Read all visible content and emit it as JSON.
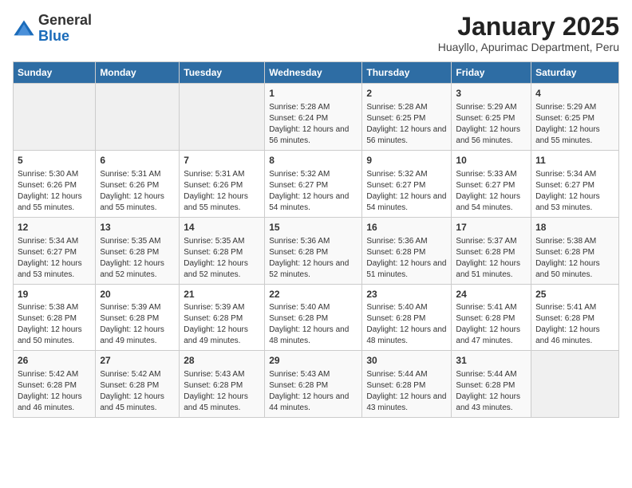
{
  "header": {
    "logo_general": "General",
    "logo_blue": "Blue",
    "title": "January 2025",
    "subtitle": "Huayllo, Apurimac Department, Peru"
  },
  "days_of_week": [
    "Sunday",
    "Monday",
    "Tuesday",
    "Wednesday",
    "Thursday",
    "Friday",
    "Saturday"
  ],
  "weeks": [
    [
      {
        "day": "",
        "info": ""
      },
      {
        "day": "",
        "info": ""
      },
      {
        "day": "",
        "info": ""
      },
      {
        "day": "1",
        "info": "Sunrise: 5:28 AM\nSunset: 6:24 PM\nDaylight: 12 hours\nand 56 minutes."
      },
      {
        "day": "2",
        "info": "Sunrise: 5:28 AM\nSunset: 6:25 PM\nDaylight: 12 hours\nand 56 minutes."
      },
      {
        "day": "3",
        "info": "Sunrise: 5:29 AM\nSunset: 6:25 PM\nDaylight: 12 hours\nand 56 minutes."
      },
      {
        "day": "4",
        "info": "Sunrise: 5:29 AM\nSunset: 6:25 PM\nDaylight: 12 hours\nand 55 minutes."
      }
    ],
    [
      {
        "day": "5",
        "info": "Sunrise: 5:30 AM\nSunset: 6:26 PM\nDaylight: 12 hours\nand 55 minutes."
      },
      {
        "day": "6",
        "info": "Sunrise: 5:31 AM\nSunset: 6:26 PM\nDaylight: 12 hours\nand 55 minutes."
      },
      {
        "day": "7",
        "info": "Sunrise: 5:31 AM\nSunset: 6:26 PM\nDaylight: 12 hours\nand 55 minutes."
      },
      {
        "day": "8",
        "info": "Sunrise: 5:32 AM\nSunset: 6:27 PM\nDaylight: 12 hours\nand 54 minutes."
      },
      {
        "day": "9",
        "info": "Sunrise: 5:32 AM\nSunset: 6:27 PM\nDaylight: 12 hours\nand 54 minutes."
      },
      {
        "day": "10",
        "info": "Sunrise: 5:33 AM\nSunset: 6:27 PM\nDaylight: 12 hours\nand 54 minutes."
      },
      {
        "day": "11",
        "info": "Sunrise: 5:34 AM\nSunset: 6:27 PM\nDaylight: 12 hours\nand 53 minutes."
      }
    ],
    [
      {
        "day": "12",
        "info": "Sunrise: 5:34 AM\nSunset: 6:27 PM\nDaylight: 12 hours\nand 53 minutes."
      },
      {
        "day": "13",
        "info": "Sunrise: 5:35 AM\nSunset: 6:28 PM\nDaylight: 12 hours\nand 52 minutes."
      },
      {
        "day": "14",
        "info": "Sunrise: 5:35 AM\nSunset: 6:28 PM\nDaylight: 12 hours\nand 52 minutes."
      },
      {
        "day": "15",
        "info": "Sunrise: 5:36 AM\nSunset: 6:28 PM\nDaylight: 12 hours\nand 52 minutes."
      },
      {
        "day": "16",
        "info": "Sunrise: 5:36 AM\nSunset: 6:28 PM\nDaylight: 12 hours\nand 51 minutes."
      },
      {
        "day": "17",
        "info": "Sunrise: 5:37 AM\nSunset: 6:28 PM\nDaylight: 12 hours\nand 51 minutes."
      },
      {
        "day": "18",
        "info": "Sunrise: 5:38 AM\nSunset: 6:28 PM\nDaylight: 12 hours\nand 50 minutes."
      }
    ],
    [
      {
        "day": "19",
        "info": "Sunrise: 5:38 AM\nSunset: 6:28 PM\nDaylight: 12 hours\nand 50 minutes."
      },
      {
        "day": "20",
        "info": "Sunrise: 5:39 AM\nSunset: 6:28 PM\nDaylight: 12 hours\nand 49 minutes."
      },
      {
        "day": "21",
        "info": "Sunrise: 5:39 AM\nSunset: 6:28 PM\nDaylight: 12 hours\nand 49 minutes."
      },
      {
        "day": "22",
        "info": "Sunrise: 5:40 AM\nSunset: 6:28 PM\nDaylight: 12 hours\nand 48 minutes."
      },
      {
        "day": "23",
        "info": "Sunrise: 5:40 AM\nSunset: 6:28 PM\nDaylight: 12 hours\nand 48 minutes."
      },
      {
        "day": "24",
        "info": "Sunrise: 5:41 AM\nSunset: 6:28 PM\nDaylight: 12 hours\nand 47 minutes."
      },
      {
        "day": "25",
        "info": "Sunrise: 5:41 AM\nSunset: 6:28 PM\nDaylight: 12 hours\nand 46 minutes."
      }
    ],
    [
      {
        "day": "26",
        "info": "Sunrise: 5:42 AM\nSunset: 6:28 PM\nDaylight: 12 hours\nand 46 minutes."
      },
      {
        "day": "27",
        "info": "Sunrise: 5:42 AM\nSunset: 6:28 PM\nDaylight: 12 hours\nand 45 minutes."
      },
      {
        "day": "28",
        "info": "Sunrise: 5:43 AM\nSunset: 6:28 PM\nDaylight: 12 hours\nand 45 minutes."
      },
      {
        "day": "29",
        "info": "Sunrise: 5:43 AM\nSunset: 6:28 PM\nDaylight: 12 hours\nand 44 minutes."
      },
      {
        "day": "30",
        "info": "Sunrise: 5:44 AM\nSunset: 6:28 PM\nDaylight: 12 hours\nand 43 minutes."
      },
      {
        "day": "31",
        "info": "Sunrise: 5:44 AM\nSunset: 6:28 PM\nDaylight: 12 hours\nand 43 minutes."
      },
      {
        "day": "",
        "info": ""
      }
    ]
  ]
}
